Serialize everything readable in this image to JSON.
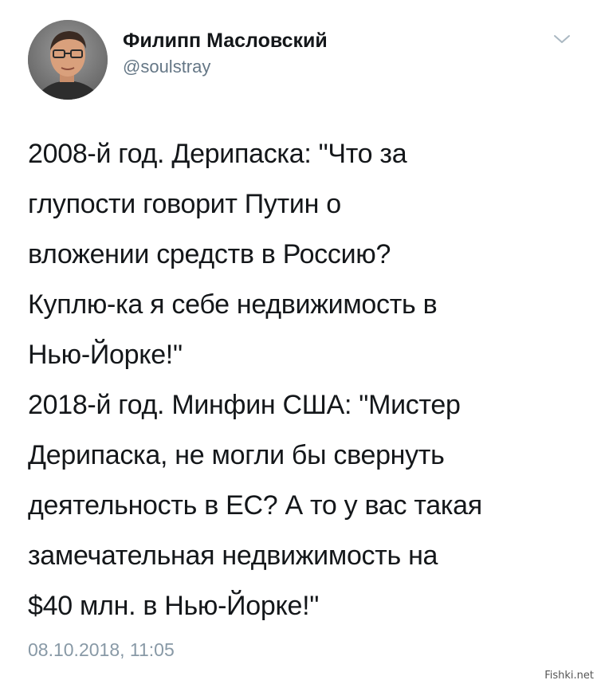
{
  "tweet": {
    "author": {
      "display_name": "Филипп Масловский",
      "handle": "@soulstray",
      "avatar_icon": "user-photo-avatar"
    },
    "menu_icon": "chevron-down-icon",
    "text_lines": [
      "2008-й год. Дерипаска: \"Что за",
      "глупости говорит Путин о",
      "вложении средств в Россию?",
      "Куплю-ка я себе недвижимость в",
      "Нью-Йорке!\"",
      "2018-й год. Минфин США: \"Мистер",
      "Дерипаска, не могли бы свернуть",
      "деятельность в ЕС? А то у вас такая",
      "замечательная недвижимость на",
      "$40 млн. в Нью-Йорке!\""
    ],
    "timestamp": "08.10.2018, 11:05"
  },
  "watermark": "Fishki.net",
  "colors": {
    "text": "#14171a",
    "secondary_text": "#657786",
    "timestamp": "#8899a6",
    "background": "#ffffff"
  }
}
